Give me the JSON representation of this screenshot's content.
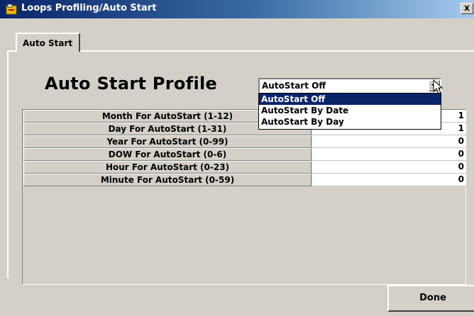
{
  "window": {
    "title": "Loops Profiling/Auto Start",
    "close_label": "x"
  },
  "tab": {
    "label": "Auto Start"
  },
  "profile": {
    "title": "Auto Start Profile",
    "combo_value": "AutoStart Off",
    "options": [
      "AutoStart Off",
      "AutoStart By Date",
      "AutoStart By Day"
    ],
    "selected_index": 0
  },
  "grid": {
    "rows": [
      {
        "label": "Month For AutoStart (1-12)",
        "value": "1"
      },
      {
        "label": "Day For AutoStart (1-31)",
        "value": "1"
      },
      {
        "label": "Year For AutoStart (0-99)",
        "value": "0"
      },
      {
        "label": "DOW For AutoStart (0-6)",
        "value": "0"
      },
      {
        "label": "Hour For AutoStart (0-23)",
        "value": "0"
      },
      {
        "label": "Minute For AutoStart (0-59)",
        "value": "0"
      }
    ]
  },
  "actions": {
    "done_label": "Done"
  },
  "colors": {
    "title_bar": "#0a246a",
    "selection": "#0a246a",
    "face": "#d4d0c8"
  }
}
